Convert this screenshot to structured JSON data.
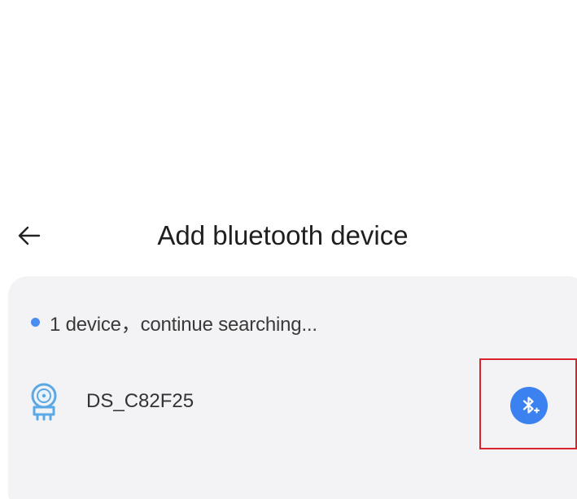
{
  "header": {
    "title": "Add bluetooth device",
    "back_icon": "arrow-left-icon"
  },
  "scan": {
    "status_text": "1 device，continue searching...",
    "status_dot_color": "#4a8df0"
  },
  "devices": [
    {
      "name": "DS_C82F25",
      "icon": "scale-device-icon",
      "action_icon": "bluetooth-add-icon",
      "action_color": "#3b82f0"
    }
  ],
  "colors": {
    "panel_bg": "#f3f3f5",
    "highlight": "#d9232f",
    "device_icon": "#5aa9e6"
  }
}
